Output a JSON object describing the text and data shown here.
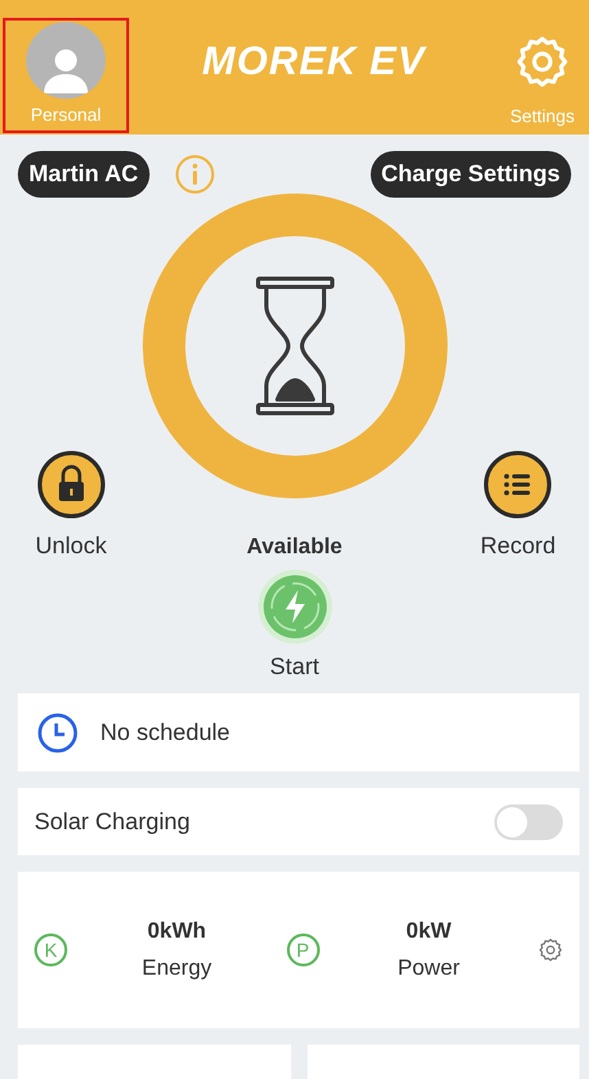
{
  "header": {
    "personal": {
      "label": "Personal",
      "highlighted": true
    },
    "logo": "MOREK EV",
    "settings": {
      "label": "Settings"
    }
  },
  "charger": {
    "name": "Martin AC",
    "settings_button": "Charge Settings"
  },
  "status": {
    "state": "Available"
  },
  "actions": [
    {
      "label": "Unlock",
      "kind": "lock"
    },
    {
      "label": "Record",
      "kind": "list"
    }
  ],
  "start": {
    "label": "Start"
  },
  "schedule": {
    "text": "No schedule"
  },
  "solar": {
    "label": "Solar Charging",
    "on": false
  },
  "metrics": [
    {
      "badge": "K",
      "value": "0kWh",
      "label": "Energy"
    },
    {
      "badge": "P",
      "value": "0kW",
      "label": "Power"
    }
  ],
  "bottom_cards": [
    {
      "kind": "empty"
    },
    {
      "kind": "empty"
    }
  ]
}
